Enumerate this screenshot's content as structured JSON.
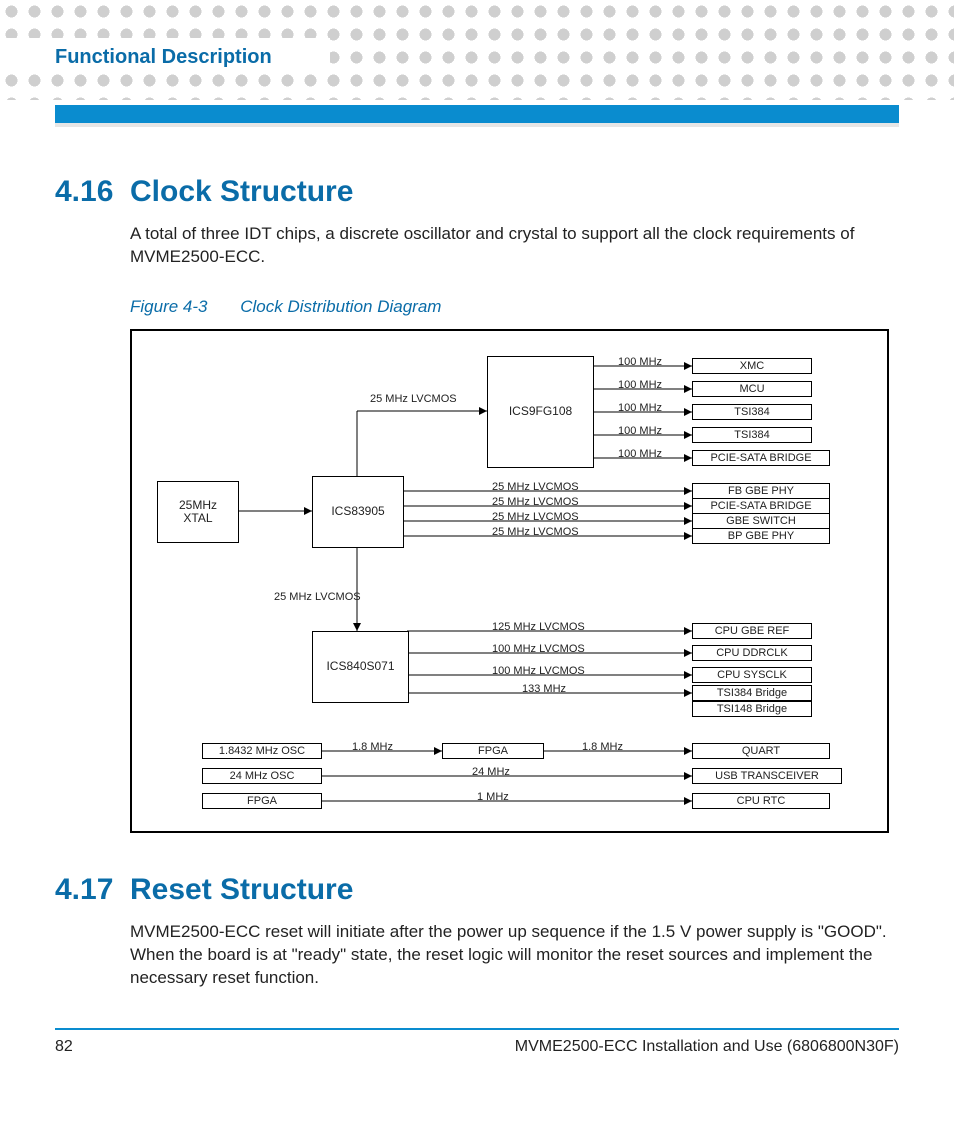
{
  "header": {
    "chapter": "Functional Description"
  },
  "section416": {
    "number": "4.16",
    "title": "Clock Structure",
    "body": "A total of three IDT chips, a discrete oscillator and crystal to support all the clock requirements of MVME2500-ECC.",
    "figure_label": "Figure 4-3",
    "figure_title": "Clock Distribution Diagram"
  },
  "section417": {
    "number": "4.17",
    "title": "Reset Structure",
    "body": "MVME2500-ECC reset will initiate after the power up sequence if the 1.5 V power supply is \"GOOD\". When the board is at \"ready\" state, the reset logic will monitor the reset sources and implement the necessary reset function."
  },
  "footer": {
    "page": "82",
    "doc": "MVME2500-ECC Installation and Use (6806800N30F)"
  },
  "diagram": {
    "big_blocks": {
      "xtal": "25MHz\nXTAL",
      "ics83905": "ICS83905",
      "ics9fg108": "ICS9FG108",
      "ics840s071": "ICS840S071"
    },
    "center_top": {
      "lvcmos_up": "25 MHz LVCMOS",
      "lvcmos_down": "25 MHz LVCMOS"
    },
    "ics9_outputs": {
      "f1": "100 MHz",
      "t1": "XMC",
      "f2": "100 MHz",
      "t2": "MCU",
      "f3": "100 MHz",
      "t3": "TSI384",
      "f4": "100 MHz",
      "t4": "TSI384",
      "f5": "100 MHz",
      "t5": "PCIE-SATA BRIDGE"
    },
    "ics83905_outputs": {
      "f1": "25 MHz LVCMOS",
      "t1": "FB GBE PHY",
      "f2": "25 MHz LVCMOS",
      "t2": "PCIE-SATA BRIDGE",
      "f3": "25 MHz LVCMOS",
      "t3": "GBE SWITCH",
      "f4": "25 MHz LVCMOS",
      "t4": "BP GBE PHY"
    },
    "ics840_outputs": {
      "f1": "125 MHz LVCMOS",
      "t1": "CPU GBE REF",
      "f2": "100 MHz LVCMOS",
      "t2": "CPU DDRCLK",
      "f3": "100 MHz LVCMOS",
      "t3": "CPU SYSCLK",
      "f4": "133 MHz",
      "t4": "TSI384 Bridge",
      "t5": "TSI148 Bridge"
    },
    "bottom": {
      "r1_left": "1.8432 MHz OSC",
      "r1_mid_f": "1.8 MHz",
      "r1_mid": "FPGA",
      "r1_right_f": "1.8 MHz",
      "r1_right": "QUART",
      "r2_left": "24 MHz OSC",
      "r2_f": "24 MHz",
      "r2_right": "USB TRANSCEIVER",
      "r3_left": "FPGA",
      "r3_f": "1 MHz",
      "r3_right": "CPU RTC"
    }
  }
}
